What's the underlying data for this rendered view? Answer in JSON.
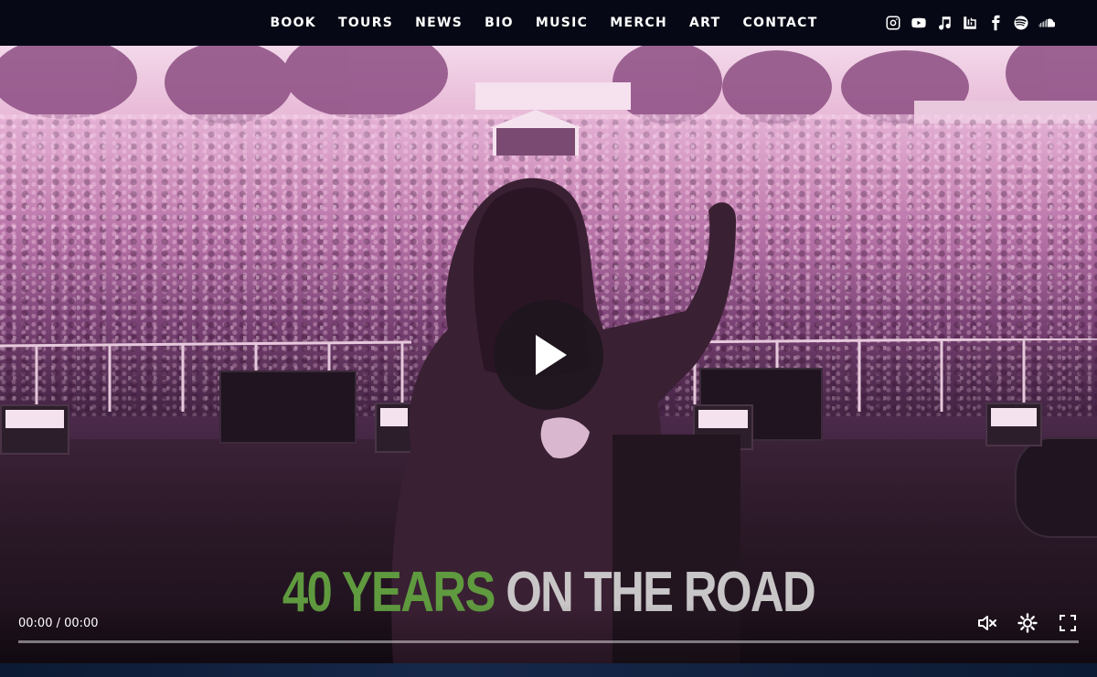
{
  "nav": {
    "items": [
      "BOOK",
      "TOURS",
      "NEWS",
      "BIO",
      "MUSIC",
      "MERCH",
      "ART",
      "CONTACT"
    ]
  },
  "social": {
    "icons": [
      "instagram-icon",
      "youtube-icon",
      "music-note-icon",
      "bandcamp-icon",
      "facebook-icon",
      "spotify-icon",
      "soundcloud-icon"
    ]
  },
  "hero": {
    "tagline_green": "40 YEARS",
    "tagline_white": " ON THE ROAD",
    "accent_green": "#5f9a3f"
  },
  "video": {
    "time_display": "00:00 / 00:00",
    "progress": 0,
    "muted": true
  }
}
